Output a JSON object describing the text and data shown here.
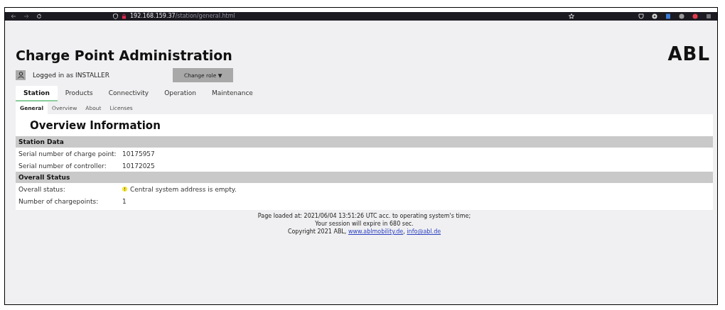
{
  "browser": {
    "url_host": "192.168.159.37",
    "url_path": "/station/general.html"
  },
  "header": {
    "title": "Charge Point Administration",
    "logo": "ABL",
    "user": "Logged in as INSTALLER",
    "role_button": "Change role ▼"
  },
  "tabs": [
    {
      "label": "Station",
      "selected": true
    },
    {
      "label": "Products",
      "selected": false
    },
    {
      "label": "Connectivity",
      "selected": false
    },
    {
      "label": "Operation",
      "selected": false
    },
    {
      "label": "Maintenance",
      "selected": false
    }
  ],
  "subtabs": [
    {
      "label": "General",
      "selected": true
    },
    {
      "label": "Overview",
      "selected": false
    },
    {
      "label": "About",
      "selected": false
    },
    {
      "label": "Licenses",
      "selected": false
    }
  ],
  "panel": {
    "heading": "Overview Information",
    "sections": [
      {
        "title": "Station Data",
        "rows": [
          {
            "label": "Serial number of charge point:",
            "value": "10175957",
            "warning": false
          },
          {
            "label": "Serial number of controller:",
            "value": "10172025",
            "warning": false
          }
        ]
      },
      {
        "title": "Overall Status",
        "rows": [
          {
            "label": "Overall status:",
            "value": "Central system address is empty.",
            "warning": true
          },
          {
            "label": "Number of chargepoints:",
            "value": "1",
            "warning": false
          }
        ]
      }
    ]
  },
  "footer": {
    "lines": [
      "Page loaded at: 2021/06/04 13:51:26 UTC acc. to operating system's time;",
      "Your session will expire in 680 sec."
    ],
    "copyright": [
      {
        "kind": "text",
        "text": "Copyright 2021 ABL, "
      },
      {
        "kind": "link",
        "text": "www.ablmobility.de"
      },
      {
        "kind": "text",
        "text": ", "
      },
      {
        "kind": "link",
        "text": "info@abl.de"
      }
    ]
  }
}
